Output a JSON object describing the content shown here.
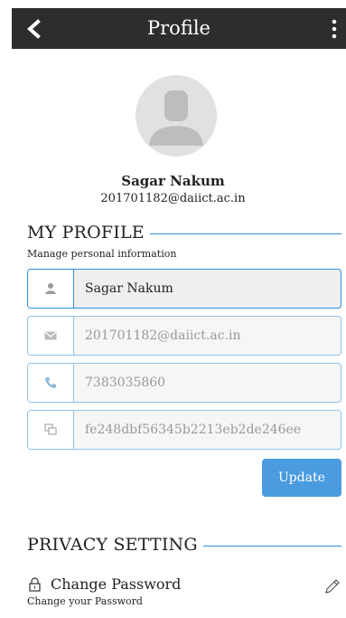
{
  "header": {
    "title": "Profile",
    "back_icon": "chevron-left-icon",
    "menu_icon": "more-vertical-icon"
  },
  "user": {
    "name": "Sagar Nakum",
    "email": "201701182@daiict.ac.in",
    "avatar_icon": "user-avatar-icon"
  },
  "my_profile": {
    "title": "MY PROFILE",
    "subtitle": "Manage personal information",
    "fields": [
      {
        "icon": "user-icon",
        "value": "Sagar Nakum"
      },
      {
        "icon": "mail-icon",
        "value": "201701182@daiict.ac.in"
      },
      {
        "icon": "phone-icon",
        "value": "7383035860"
      },
      {
        "icon": "device-icon",
        "value": "fe248dbf56345b2213eb2de246ee"
      }
    ],
    "update_label": "Update"
  },
  "privacy": {
    "title": "PRIVACY SETTING",
    "change_password_title": "Change Password",
    "change_password_sub": "Change your Password",
    "lock_icon": "lock-icon",
    "edit_icon": "pencil-icon"
  },
  "colors": {
    "header_bg": "#2d2d2d",
    "accent": "#3a90d9",
    "button": "#4a9be0"
  }
}
